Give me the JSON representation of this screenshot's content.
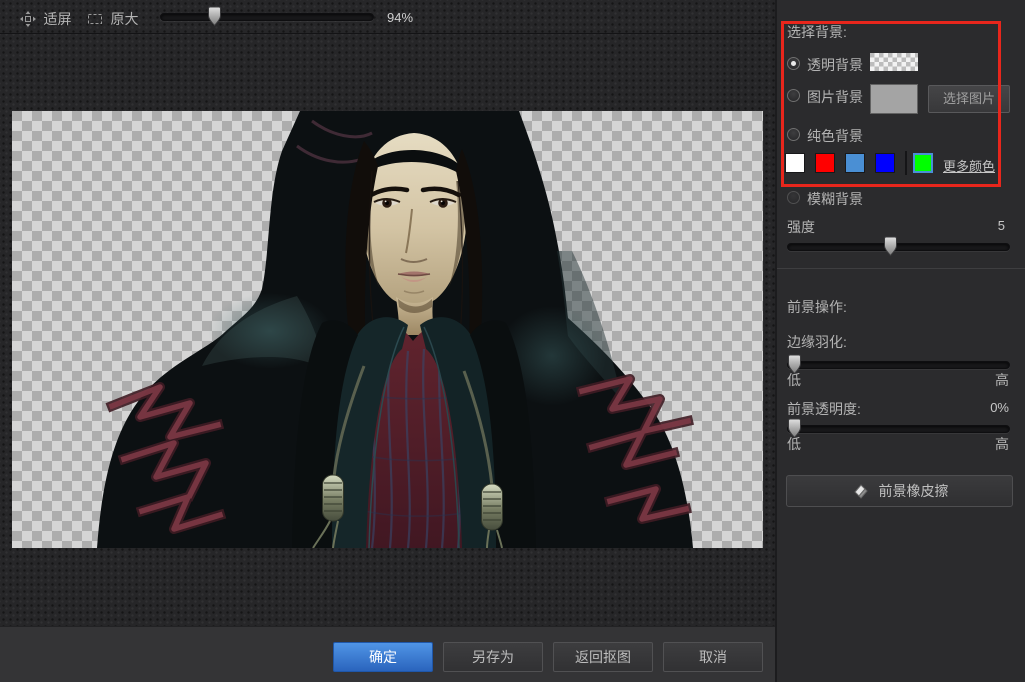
{
  "colors": {
    "accent_blue": "#2f6fc9",
    "highlight_red": "#e8261c",
    "panel_bg": "#2b2b2d",
    "swatch_selected_border": "#4a8fd6"
  },
  "toolbar": {
    "fit_screen_label": "适屏",
    "original_size_label": "原大",
    "zoom_percent": "94%"
  },
  "background_panel": {
    "title": "选择背景:",
    "options": [
      {
        "label": "透明背景",
        "selected": true
      },
      {
        "label": "图片背景",
        "selected": false
      },
      {
        "label": "纯色背景",
        "selected": false
      },
      {
        "label": "模糊背景",
        "selected": false
      }
    ],
    "choose_image_button": "选择图片",
    "color_swatches": [
      "#ffffff",
      "#ff0000",
      "#4a8fd4",
      "#0000ff",
      "#00ff00"
    ],
    "selected_swatch_index": 4,
    "more_colors_link": "更多颜色",
    "intensity_label": "强度",
    "intensity_value": "5"
  },
  "foreground_panel": {
    "title": "前景操作:",
    "feather_label": "边缘羽化:",
    "low_label": "低",
    "high_label": "高",
    "opacity_label": "前景透明度:",
    "opacity_value": "0%",
    "eraser_button": "前景橡皮擦"
  },
  "footer": {
    "confirm_button": "确定",
    "save_as_button": "另存为",
    "back_to_cutout_button": "返回抠图",
    "cancel_button": "取消"
  }
}
